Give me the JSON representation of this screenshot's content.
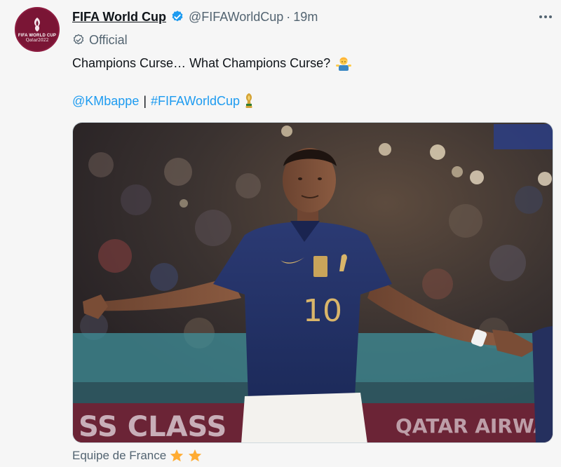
{
  "tweet": {
    "display_name": "FIFA World Cup",
    "handle": "@FIFAWorldCup",
    "separator": "·",
    "time": "19m",
    "badge_label": "Official",
    "text": "Champions Curse… What Champions Curse?",
    "mention": "@KMbappe",
    "pipe": "|",
    "hashtag": "#FIFAWorldCup",
    "caption": "Equipe de France"
  },
  "avatar": {
    "line1": "FIFA WORLD CUP",
    "line2": "Qatar2022"
  },
  "photo": {
    "jersey_number": "10",
    "billboard_left": "SS CLASS",
    "billboard_right": "QATAR AIRWAYS"
  },
  "icons": {
    "verified": "verified-badge-icon",
    "official": "official-check-icon",
    "shrug": "person-shrugging-emoji",
    "trophy": "trophy-emoji",
    "stars": [
      "star-emoji",
      "star-emoji"
    ]
  },
  "colors": {
    "link": "#1d9bf0",
    "verified": "#1d9bf0",
    "avatar_bg": "#7a1535",
    "secondary_text": "#536471"
  }
}
